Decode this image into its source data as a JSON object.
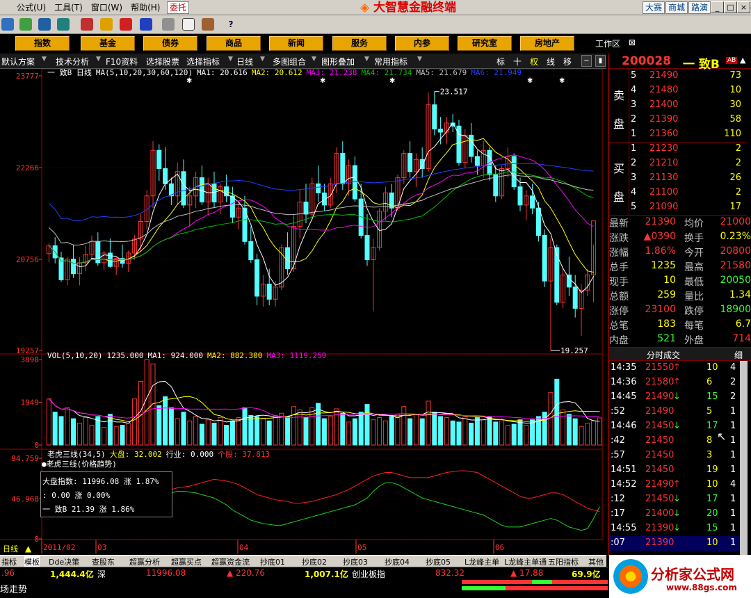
{
  "app_title": "大智慧金融终端",
  "menu": [
    "公式(U)",
    "工具(T)",
    "窗口(W)",
    "帮助(H)"
  ],
  "weituo": "委托",
  "right_links": [
    "大赛",
    "商城",
    "路演"
  ],
  "win_controls": [
    "_",
    "□",
    "×"
  ],
  "nav_buttons": [
    "指数",
    "基金",
    "债券",
    "商品",
    "新闻",
    "服务",
    "内参",
    "研究室",
    "房地产"
  ],
  "workspace": "工作区",
  "chart_toolbar": [
    "默认方案",
    "技术分析",
    "F10资料",
    "选择股票",
    "选择指标",
    "日线",
    "多图组合",
    "图形叠加",
    "常用指标"
  ],
  "chart_toolbar_small": [
    "标",
    "十",
    "权",
    "线",
    "移"
  ],
  "stock": {
    "code": "200028",
    "name": "一  致B",
    "badge": "AB"
  },
  "order_book": {
    "sell_label": [
      "卖",
      "盘"
    ],
    "buy_label": [
      "买",
      "盘"
    ],
    "sell": [
      {
        "idx": "5",
        "price": "21490",
        "vol": "73"
      },
      {
        "idx": "4",
        "price": "21480",
        "vol": "10"
      },
      {
        "idx": "3",
        "price": "21400",
        "vol": "30"
      },
      {
        "idx": "2",
        "price": "21390",
        "vol": "58"
      },
      {
        "idx": "1",
        "price": "21360",
        "vol": "110"
      }
    ],
    "buy": [
      {
        "idx": "1",
        "price": "21230",
        "vol": "2"
      },
      {
        "idx": "2",
        "price": "21210",
        "vol": "2"
      },
      {
        "idx": "3",
        "price": "21130",
        "vol": "26"
      },
      {
        "idx": "4",
        "price": "21100",
        "vol": "2"
      },
      {
        "idx": "5",
        "price": "21090",
        "vol": "17"
      }
    ]
  },
  "quotes": [
    {
      "l": "最新",
      "v": "21390",
      "l2": "均价",
      "v2": "21000"
    },
    {
      "l": "涨跌",
      "v": "▲0390",
      "l2": "换手",
      "v2": "0.23%"
    },
    {
      "l": "涨幅",
      "v": "1.86%",
      "l2": "今开",
      "v2": "20800"
    },
    {
      "l": "总手",
      "v": "1235",
      "l2": "最高",
      "v2": "21580"
    },
    {
      "l": "现手",
      "v": "10",
      "l2": "最低",
      "v2": "20050"
    },
    {
      "l": "总额",
      "v": "259",
      "l2": "量比",
      "v2": "1.34"
    },
    {
      "l": "涨停",
      "v": "23100",
      "l2": "跌停",
      "v2": "18900"
    },
    {
      "l": "总笔",
      "v": "183",
      "l2": "每笔",
      "v2": "6.7"
    },
    {
      "l": "内盘",
      "v": "521",
      "l2": "外盘",
      "v2": "714"
    }
  ],
  "trades_header": "分时成交",
  "trades_tab": "细",
  "trades": [
    {
      "t": "14:35",
      "p": "21550",
      "a": "↑",
      "v": "10",
      "n": "4"
    },
    {
      "t": "14:36",
      "p": "21580",
      "a": "↑",
      "v": "6",
      "n": "2"
    },
    {
      "t": "14:45",
      "p": "21490",
      "a": "↓",
      "v": "15",
      "n": "2"
    },
    {
      "t": ":52",
      "p": "21490",
      "a": "",
      "v": "5",
      "n": "1"
    },
    {
      "t": "14:46",
      "p": "21450",
      "a": "↓",
      "v": "17",
      "n": "1"
    },
    {
      "t": ":42",
      "p": "21450",
      "a": "",
      "v": "8",
      "n": "1"
    },
    {
      "t": ":57",
      "p": "21450",
      "a": "",
      "v": "3",
      "n": "1"
    },
    {
      "t": "14:51",
      "p": "21450",
      "a": "",
      "v": "19",
      "n": "1"
    },
    {
      "t": "14:52",
      "p": "21490",
      "a": "↑",
      "v": "10",
      "n": "4"
    },
    {
      "t": ":12",
      "p": "21450",
      "a": "↓",
      "v": "17",
      "n": "1"
    },
    {
      "t": ":17",
      "p": "21400",
      "a": "↓",
      "v": "20",
      "n": "1"
    },
    {
      "t": "14:55",
      "p": "21390",
      "a": "↓",
      "v": "15",
      "n": "1"
    },
    {
      "t": ":07",
      "p": "21390",
      "a": "",
      "v": "10",
      "n": "1"
    }
  ],
  "main_legend": {
    "name": "一  致B 日线",
    "ma_params": "MA(5,10,20,30,60,120)",
    "ma1": "MA1: 20.616",
    "ma2": "MA2: 20.612",
    "ma3": "MA3: 21.238",
    "ma4": "MA4: 21.734",
    "ma5": "MA5: 21.679",
    "ma6": "MA6: 21.949"
  },
  "hi_label": "23.517",
  "lo_label": "19.257",
  "vol_legend": {
    "name": "VOL(5,10,20)",
    "v": "1235.000",
    "ma1": "MA1: 924.000",
    "ma2": "MA2: 882.300",
    "ma3": "MA3: 1119.250"
  },
  "ind_legend": {
    "name": "老虎三线(34,5)",
    "dapan": "大盘: 32.002",
    "hangye": "行业: 0.000",
    "gegu": "个股: 37.813",
    "sub": "●老虎三线(价格趋势)"
  },
  "tooltip": {
    "r1": "大盘指数:  11996.08  涨  1.87%",
    "r2": ": 0.00   涨  0.00%",
    "r3": "一   致B       21.39   涨  1.86%"
  },
  "dates": [
    "2011/02",
    "03",
    "04",
    "05",
    "06"
  ],
  "period": "日线",
  "sheet_tabs": [
    "指标",
    "模板",
    "Dde决策",
    "查股东",
    "超赢分析",
    "超赢买点",
    "超赢资金流",
    "抄底01",
    "抄底02",
    "抄底03",
    "抄底04",
    "抄底05",
    "L龙峰主单",
    "L龙峰主单通",
    "五阳指标",
    "其他"
  ],
  "status1": {
    "a": ".96",
    "b": "1,444.4亿",
    "c": "深",
    "d": "11996.08",
    "e": "▲ 220.76",
    "f": "1,007.1亿",
    "g": "创业板指",
    "h": "832.32",
    "i": "▲ 17.88",
    "j": "69.9亿"
  },
  "status2": "场走势",
  "watermark": {
    "cn": "分析家公式网",
    "url": "www.88gs.com"
  },
  "colors": {
    "up": "#ff3333",
    "down": "#54ffff",
    "ma1": "#ffffff",
    "ma2": "#ffff00",
    "ma3": "#ff00ff",
    "ma4": "#00c000",
    "ma5": "#c0c0c0",
    "ma6": "#2040ff"
  },
  "chart_data": [
    {
      "type": "candlestick",
      "title": "一  致B 日线",
      "y_ticks": [
        19257,
        20756,
        22266,
        23777
      ],
      "ylim": [
        19257,
        23777
      ],
      "ohlc": [
        [
          20850,
          21030,
          20710,
          20980
        ],
        [
          20980,
          21120,
          20690,
          20780
        ],
        [
          20780,
          20880,
          20390,
          20420
        ],
        [
          20420,
          20800,
          20330,
          20760
        ],
        [
          20760,
          21000,
          20450,
          20520
        ],
        [
          20520,
          20790,
          20330,
          20700
        ],
        [
          20700,
          20980,
          20560,
          20840
        ],
        [
          20840,
          21150,
          20750,
          21050
        ],
        [
          21050,
          21200,
          20650,
          20700
        ],
        [
          20700,
          20900,
          20580,
          20860
        ],
        [
          20860,
          21100,
          20620,
          20640
        ],
        [
          20640,
          20790,
          20500,
          20770
        ],
        [
          20770,
          21000,
          20620,
          20690
        ],
        [
          20690,
          20900,
          20550,
          20860
        ],
        [
          20860,
          21160,
          20750,
          21090
        ],
        [
          21090,
          21500,
          20880,
          21380
        ],
        [
          21380,
          21900,
          21250,
          21800
        ],
        [
          21800,
          22700,
          21600,
          22550
        ],
        [
          22550,
          22650,
          22050,
          22250
        ],
        [
          22250,
          22600,
          21900,
          22000
        ],
        [
          22000,
          22100,
          21650,
          21800
        ],
        [
          21800,
          22350,
          21650,
          22200
        ],
        [
          22200,
          22400,
          21600,
          21650
        ],
        [
          21650,
          21950,
          21300,
          21800
        ],
        [
          21800,
          22200,
          21600,
          22100
        ],
        [
          22100,
          22300,
          21650,
          21700
        ],
        [
          21700,
          22100,
          21500,
          22000
        ],
        [
          22000,
          22200,
          21600,
          21700
        ],
        [
          21700,
          22000,
          21500,
          21950
        ],
        [
          21950,
          22150,
          21700,
          21800
        ],
        [
          21800,
          21950,
          21350,
          21450
        ],
        [
          21450,
          21700,
          21250,
          21600
        ],
        [
          21600,
          21800,
          21000,
          21050
        ],
        [
          21050,
          21300,
          20700,
          20750
        ],
        [
          20750,
          20850,
          20000,
          20150
        ],
        [
          20150,
          20500,
          19980,
          20350
        ],
        [
          20350,
          20600,
          20000,
          20100
        ],
        [
          20100,
          20400,
          19980,
          20300
        ],
        [
          20300,
          21000,
          20250,
          20950
        ],
        [
          20950,
          21200,
          20500,
          20600
        ],
        [
          20600,
          21500,
          20550,
          21300
        ],
        [
          21300,
          21900,
          21100,
          21700
        ],
        [
          21700,
          22000,
          21350,
          21500
        ],
        [
          21500,
          22100,
          21400,
          22000
        ],
        [
          22000,
          22300,
          21700,
          21850
        ],
        [
          21850,
          22000,
          21550,
          21650
        ],
        [
          21650,
          22100,
          21600,
          22000
        ],
        [
          22000,
          22600,
          21850,
          22500
        ],
        [
          22500,
          22700,
          21900,
          22000
        ],
        [
          22000,
          22400,
          21800,
          22300
        ],
        [
          22300,
          22450,
          21700,
          21750
        ],
        [
          21750,
          22000,
          21100,
          21150
        ],
        [
          21150,
          21500,
          20650,
          20750
        ],
        [
          20750,
          21100,
          19900,
          20950
        ],
        [
          20950,
          21600,
          20900,
          21550
        ],
        [
          21550,
          21950,
          21400,
          21850
        ],
        [
          21850,
          22000,
          21450,
          21600
        ],
        [
          21600,
          22150,
          21550,
          22100
        ],
        [
          22100,
          22550,
          22000,
          22500
        ],
        [
          22500,
          22700,
          22100,
          22200
        ],
        [
          22200,
          22500,
          21950,
          22400
        ],
        [
          22400,
          22600,
          22100,
          22250
        ],
        [
          22250,
          23500,
          22200,
          23300
        ],
        [
          23300,
          23517,
          22800,
          22900
        ],
        [
          22900,
          23100,
          22650,
          22850
        ],
        [
          22850,
          23100,
          22650,
          23000
        ],
        [
          23000,
          23150,
          22850,
          22950
        ],
        [
          22950,
          23050,
          22300,
          22350
        ],
        [
          22350,
          22900,
          22250,
          22800
        ],
        [
          22800,
          23000,
          22350,
          22450
        ],
        [
          22450,
          22550,
          22150,
          22300
        ],
        [
          22300,
          22700,
          22100,
          22550
        ],
        [
          22550,
          22600,
          22050,
          22150
        ],
        [
          22150,
          22300,
          21700,
          21800
        ],
        [
          21800,
          22300,
          21750,
          22250
        ],
        [
          22250,
          22600,
          22100,
          22450
        ],
        [
          22450,
          22500,
          21900,
          21950
        ],
        [
          21950,
          22100,
          21550,
          21650
        ],
        [
          21650,
          21900,
          21400,
          21800
        ],
        [
          21800,
          22000,
          21500,
          21600
        ],
        [
          21600,
          21700,
          21050,
          21150
        ],
        [
          21150,
          21250,
          20300,
          20400
        ],
        [
          20400,
          21100,
          19257,
          20950
        ],
        [
          20950,
          21000,
          20000,
          20050
        ],
        [
          20050,
          20600,
          19950,
          20500
        ],
        [
          20500,
          20800,
          20150,
          20300
        ],
        [
          20300,
          20500,
          19800,
          19950
        ],
        [
          19950,
          20350,
          19500,
          20250
        ],
        [
          20250,
          20600,
          20150,
          20500
        ],
        [
          20500,
          21000,
          20050,
          21390
        ]
      ]
    },
    {
      "type": "bar",
      "title": "VOL(5,10,20)",
      "y_ticks": [
        0,
        1949,
        3898
      ],
      "ylim": [
        0,
        3898
      ],
      "values": [
        2100,
        1500,
        1300,
        1700,
        1200,
        1000,
        1250,
        900,
        1300,
        800,
        1400,
        850,
        900,
        1000,
        2100,
        2900,
        3898,
        3700,
        1800,
        2200,
        1700,
        1200,
        1500,
        1100,
        1300,
        950,
        1150,
        1000,
        1250,
        900,
        1100,
        1250,
        1700,
        1350,
        1300,
        1200,
        1100,
        1350,
        1450,
        1300,
        1750,
        1600,
        1250,
        1700,
        1900,
        1200,
        1300,
        1650,
        1450,
        1050,
        1200,
        1500,
        1850,
        1150,
        1250,
        1100,
        1300,
        1400,
        1750,
        1200,
        1400,
        1200,
        2000,
        1500,
        1300,
        1250,
        1100,
        1050,
        1300,
        1000,
        1250,
        1150,
        1300,
        1050,
        1100,
        900,
        950,
        1150,
        900,
        1150,
        1300,
        1500,
        2400,
        3000,
        1600,
        1400,
        1200,
        850,
        1000,
        1100,
        1235
      ]
    },
    {
      "type": "line",
      "title": "老虎三线(34,5)",
      "y_ticks": [
        0,
        46.968,
        94.759
      ],
      "ylim": [
        0,
        94.759
      ],
      "series": [
        {
          "name": "大盘",
          "values": [
            68,
            66,
            64,
            62,
            58,
            54,
            50,
            44,
            38,
            34,
            32,
            30,
            31,
            33,
            35,
            38,
            40,
            44,
            50,
            54,
            58,
            60,
            61,
            62,
            64,
            66,
            68,
            70,
            69,
            68,
            66,
            64,
            60,
            56,
            52,
            50,
            48,
            46,
            45,
            44,
            42,
            42,
            43,
            44,
            46,
            48,
            50,
            52,
            55,
            58,
            62,
            66,
            70,
            74,
            76,
            78,
            78,
            76,
            74,
            72,
            72,
            72,
            72,
            74,
            76,
            78,
            79,
            80,
            80,
            79,
            78,
            74,
            70,
            66,
            62,
            58,
            54,
            50,
            48,
            48,
            50,
            52,
            54,
            54,
            52,
            48,
            44,
            40,
            36,
            34,
            32
          ]
        },
        {
          "name": "个股",
          "values": [
            54,
            52,
            50,
            46,
            44,
            42,
            40,
            38,
            36,
            34,
            34,
            34,
            36,
            36,
            38,
            40,
            44,
            48,
            50,
            52,
            54,
            56,
            56,
            55,
            54,
            52,
            50,
            48,
            44,
            40,
            34,
            30,
            26,
            22,
            20,
            18,
            17,
            16,
            16,
            18,
            20,
            22,
            24,
            26,
            28,
            30,
            32,
            34,
            36,
            38,
            40,
            44,
            48,
            56,
            62,
            66,
            66,
            64,
            60,
            56,
            52,
            48,
            46,
            44,
            42,
            40,
            38,
            36,
            34,
            32,
            30,
            28,
            24,
            20,
            16,
            14,
            14,
            14,
            16,
            18,
            20,
            22,
            24,
            22,
            18,
            14,
            12,
            10,
            12,
            24,
            38
          ]
        }
      ]
    }
  ]
}
